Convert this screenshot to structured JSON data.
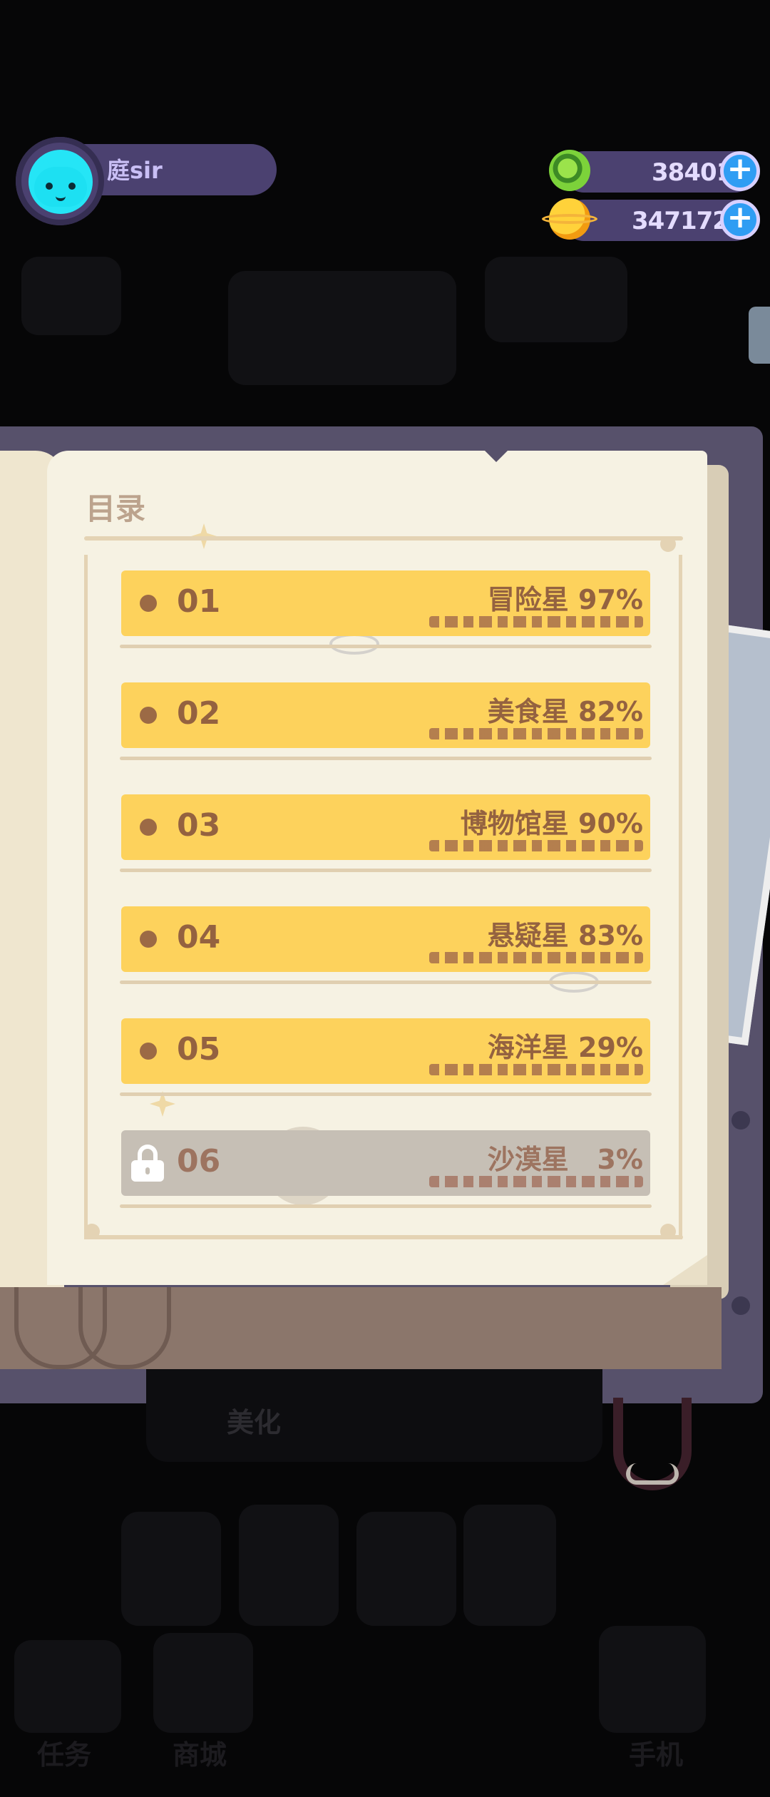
{
  "player": {
    "name": "庭sir"
  },
  "currencies": [
    {
      "icon": "green-donut-coin-icon",
      "value": "38401"
    },
    {
      "icon": "planet-coin-icon",
      "value": "3471722"
    }
  ],
  "catalog": {
    "title": "目录",
    "chapters": [
      {
        "number": "01",
        "name": "冒险星",
        "percent": "97%",
        "locked": false
      },
      {
        "number": "02",
        "name": "美食星",
        "percent": "82%",
        "locked": false
      },
      {
        "number": "03",
        "name": "博物馆星",
        "percent": "90%",
        "locked": false
      },
      {
        "number": "04",
        "name": "悬疑星",
        "percent": "83%",
        "locked": false
      },
      {
        "number": "05",
        "name": "海洋星",
        "percent": "29%",
        "locked": false
      },
      {
        "number": "06",
        "name": "沙漠星",
        "percent": "3%",
        "locked": true
      }
    ]
  },
  "background": {
    "beautify_label": "美化",
    "nav_tasks": "任务",
    "nav_shop": "商城",
    "nav_phone": "手机"
  },
  "colors": {
    "chapter_open": "#fdd25c",
    "chapter_locked": "#c6bfb5",
    "page": "#f6f2e3",
    "hud_bar": "#4b4170",
    "plus_button": "#2f9df3"
  }
}
